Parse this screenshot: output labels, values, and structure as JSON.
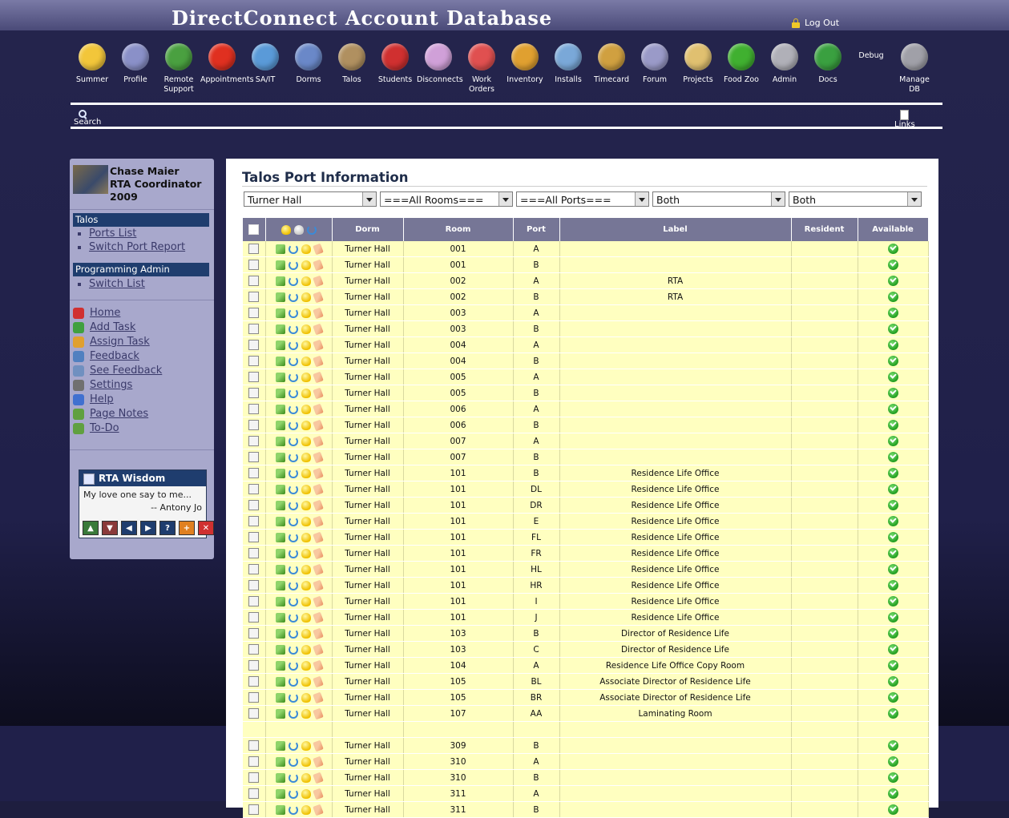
{
  "app": {
    "title": "DirectConnect Account Database",
    "logout_label": "Log Out"
  },
  "nav": [
    {
      "label": "Summer",
      "icon": "sunglasses-smiley-icon",
      "color": "#f2c63a"
    },
    {
      "label": "Profile",
      "icon": "profile-card-icon",
      "color": "#8a90c8"
    },
    {
      "label": "Remote Support",
      "icon": "remote-support-globe-icon",
      "color": "#4aa040"
    },
    {
      "label": "Appointments",
      "icon": "alarm-clock-icon",
      "color": "#e03020"
    },
    {
      "label": "SA/IT",
      "icon": "red-cross-icon",
      "color": "#5a9ad8"
    },
    {
      "label": "Dorms",
      "icon": "building-icon",
      "color": "#6a88c8"
    },
    {
      "label": "Talos",
      "icon": "skull-helmet-icon",
      "color": "#b09060"
    },
    {
      "label": "Students",
      "icon": "student-icon",
      "color": "#d03030"
    },
    {
      "label": "Disconnects",
      "icon": "disconnect-icon",
      "color": "#d0a0d8"
    },
    {
      "label": "Work Orders",
      "icon": "work-order-icon",
      "color": "#e05050"
    },
    {
      "label": "Inventory",
      "icon": "box-icon",
      "color": "#e0a030"
    },
    {
      "label": "Installs",
      "icon": "install-disc-icon",
      "color": "#7aa8d8"
    },
    {
      "label": "Timecard",
      "icon": "money-bag-icon",
      "color": "#d0a040"
    },
    {
      "label": "Forum",
      "icon": "speech-bubble-icon",
      "color": "#9a9ac8"
    },
    {
      "label": "Projects",
      "icon": "folder-icon",
      "color": "#e0c070"
    },
    {
      "label": "Food Zoo",
      "icon": "apple-icon",
      "color": "#40b030"
    },
    {
      "label": "Admin",
      "icon": "network-cloud-icon",
      "color": "#b0b0b8"
    },
    {
      "label": "Docs",
      "icon": "books-icon",
      "color": "#3aa040"
    },
    {
      "label": "Manage DB",
      "icon": "database-check-icon",
      "color": "#a0a0a8"
    }
  ],
  "debug_label": "Debug",
  "search_label": "Search",
  "links_label": "Links",
  "user": {
    "name": "Chase Maier",
    "role": "RTA Coordinator",
    "year": "2009"
  },
  "sidebar": {
    "section1": {
      "title": "Talos",
      "links": [
        "Ports List",
        "Switch Port Report"
      ]
    },
    "section2": {
      "title": "Programming Admin",
      "links": [
        "Switch List"
      ]
    },
    "menu": [
      {
        "label": "Home",
        "icon": "home-icon",
        "color": "#d03030"
      },
      {
        "label": "Add Task",
        "icon": "checkbox-icon",
        "color": "#40a040"
      },
      {
        "label": "Assign Task",
        "icon": "assign-user-icon",
        "color": "#e0a030"
      },
      {
        "label": "Feedback",
        "icon": "info-icon",
        "color": "#5080c0"
      },
      {
        "label": "See Feedback",
        "icon": "magnifier-icon",
        "color": "#7090c0"
      },
      {
        "label": "Settings",
        "icon": "tools-icon",
        "color": "#707070"
      },
      {
        "label": "Help",
        "icon": "help-icon",
        "color": "#4070d0"
      },
      {
        "label": "Page Notes",
        "icon": "notepad-icon",
        "color": "#60a040"
      },
      {
        "label": "To-Do",
        "icon": "todo-icon",
        "color": "#60a040"
      }
    ]
  },
  "wisdom": {
    "title": "RTA Wisdom",
    "quote": "My love one say to me...",
    "author": "-- Antony Jo"
  },
  "main": {
    "title": "Talos Port Information",
    "filters": [
      "Turner Hall",
      "===All Rooms===",
      "===All Ports===",
      "Both",
      "Both"
    ],
    "columns": [
      "Dorm",
      "Room",
      "Port",
      "Label",
      "Resident",
      "Available"
    ]
  },
  "rows": [
    {
      "dorm": "Turner Hall",
      "room": "001",
      "port": "A",
      "label": "",
      "resident": ""
    },
    {
      "dorm": "Turner Hall",
      "room": "001",
      "port": "B",
      "label": "",
      "resident": ""
    },
    {
      "dorm": "Turner Hall",
      "room": "002",
      "port": "A",
      "label": "RTA",
      "resident": ""
    },
    {
      "dorm": "Turner Hall",
      "room": "002",
      "port": "B",
      "label": "RTA",
      "resident": ""
    },
    {
      "dorm": "Turner Hall",
      "room": "003",
      "port": "A",
      "label": "",
      "resident": ""
    },
    {
      "dorm": "Turner Hall",
      "room": "003",
      "port": "B",
      "label": "",
      "resident": ""
    },
    {
      "dorm": "Turner Hall",
      "room": "004",
      "port": "A",
      "label": "",
      "resident": ""
    },
    {
      "dorm": "Turner Hall",
      "room": "004",
      "port": "B",
      "label": "",
      "resident": ""
    },
    {
      "dorm": "Turner Hall",
      "room": "005",
      "port": "A",
      "label": "",
      "resident": ""
    },
    {
      "dorm": "Turner Hall",
      "room": "005",
      "port": "B",
      "label": "",
      "resident": ""
    },
    {
      "dorm": "Turner Hall",
      "room": "006",
      "port": "A",
      "label": "",
      "resident": ""
    },
    {
      "dorm": "Turner Hall",
      "room": "006",
      "port": "B",
      "label": "",
      "resident": ""
    },
    {
      "dorm": "Turner Hall",
      "room": "007",
      "port": "A",
      "label": "",
      "resident": ""
    },
    {
      "dorm": "Turner Hall",
      "room": "007",
      "port": "B",
      "label": "",
      "resident": ""
    },
    {
      "dorm": "Turner Hall",
      "room": "101",
      "port": "B",
      "label": "Residence Life Office",
      "resident": ""
    },
    {
      "dorm": "Turner Hall",
      "room": "101",
      "port": "DL",
      "label": "Residence Life Office",
      "resident": ""
    },
    {
      "dorm": "Turner Hall",
      "room": "101",
      "port": "DR",
      "label": "Residence Life Office",
      "resident": ""
    },
    {
      "dorm": "Turner Hall",
      "room": "101",
      "port": "E",
      "label": "Residence Life Office",
      "resident": ""
    },
    {
      "dorm": "Turner Hall",
      "room": "101",
      "port": "FL",
      "label": "Residence Life Office",
      "resident": ""
    },
    {
      "dorm": "Turner Hall",
      "room": "101",
      "port": "FR",
      "label": "Residence Life Office",
      "resident": ""
    },
    {
      "dorm": "Turner Hall",
      "room": "101",
      "port": "HL",
      "label": "Residence Life Office",
      "resident": ""
    },
    {
      "dorm": "Turner Hall",
      "room": "101",
      "port": "HR",
      "label": "Residence Life Office",
      "resident": ""
    },
    {
      "dorm": "Turner Hall",
      "room": "101",
      "port": "I",
      "label": "Residence Life Office",
      "resident": ""
    },
    {
      "dorm": "Turner Hall",
      "room": "101",
      "port": "J",
      "label": "Residence Life Office",
      "resident": ""
    },
    {
      "dorm": "Turner Hall",
      "room": "103",
      "port": "B",
      "label": "Director of Residence Life",
      "resident": ""
    },
    {
      "dorm": "Turner Hall",
      "room": "103",
      "port": "C",
      "label": "Director of Residence Life",
      "resident": ""
    },
    {
      "dorm": "Turner Hall",
      "room": "104",
      "port": "A",
      "label": "Residence Life Office Copy Room",
      "resident": ""
    },
    {
      "dorm": "Turner Hall",
      "room": "105",
      "port": "BL",
      "label": "Associate Director of Residence Life",
      "resident": ""
    },
    {
      "dorm": "Turner Hall",
      "room": "105",
      "port": "BR",
      "label": "Associate Director of Residence Life",
      "resident": ""
    },
    {
      "dorm": "Turner Hall",
      "room": "107",
      "port": "AA",
      "label": "Laminating Room",
      "resident": ""
    },
    {
      "gap": true
    },
    {
      "dorm": "Turner Hall",
      "room": "309",
      "port": "B",
      "label": "",
      "resident": ""
    },
    {
      "dorm": "Turner Hall",
      "room": "310",
      "port": "A",
      "label": "",
      "resident": ""
    },
    {
      "dorm": "Turner Hall",
      "room": "310",
      "port": "B",
      "label": "",
      "resident": ""
    },
    {
      "dorm": "Turner Hall",
      "room": "311",
      "port": "A",
      "label": "",
      "resident": ""
    },
    {
      "dorm": "Turner Hall",
      "room": "311",
      "port": "B",
      "label": "",
      "resident": ""
    }
  ]
}
